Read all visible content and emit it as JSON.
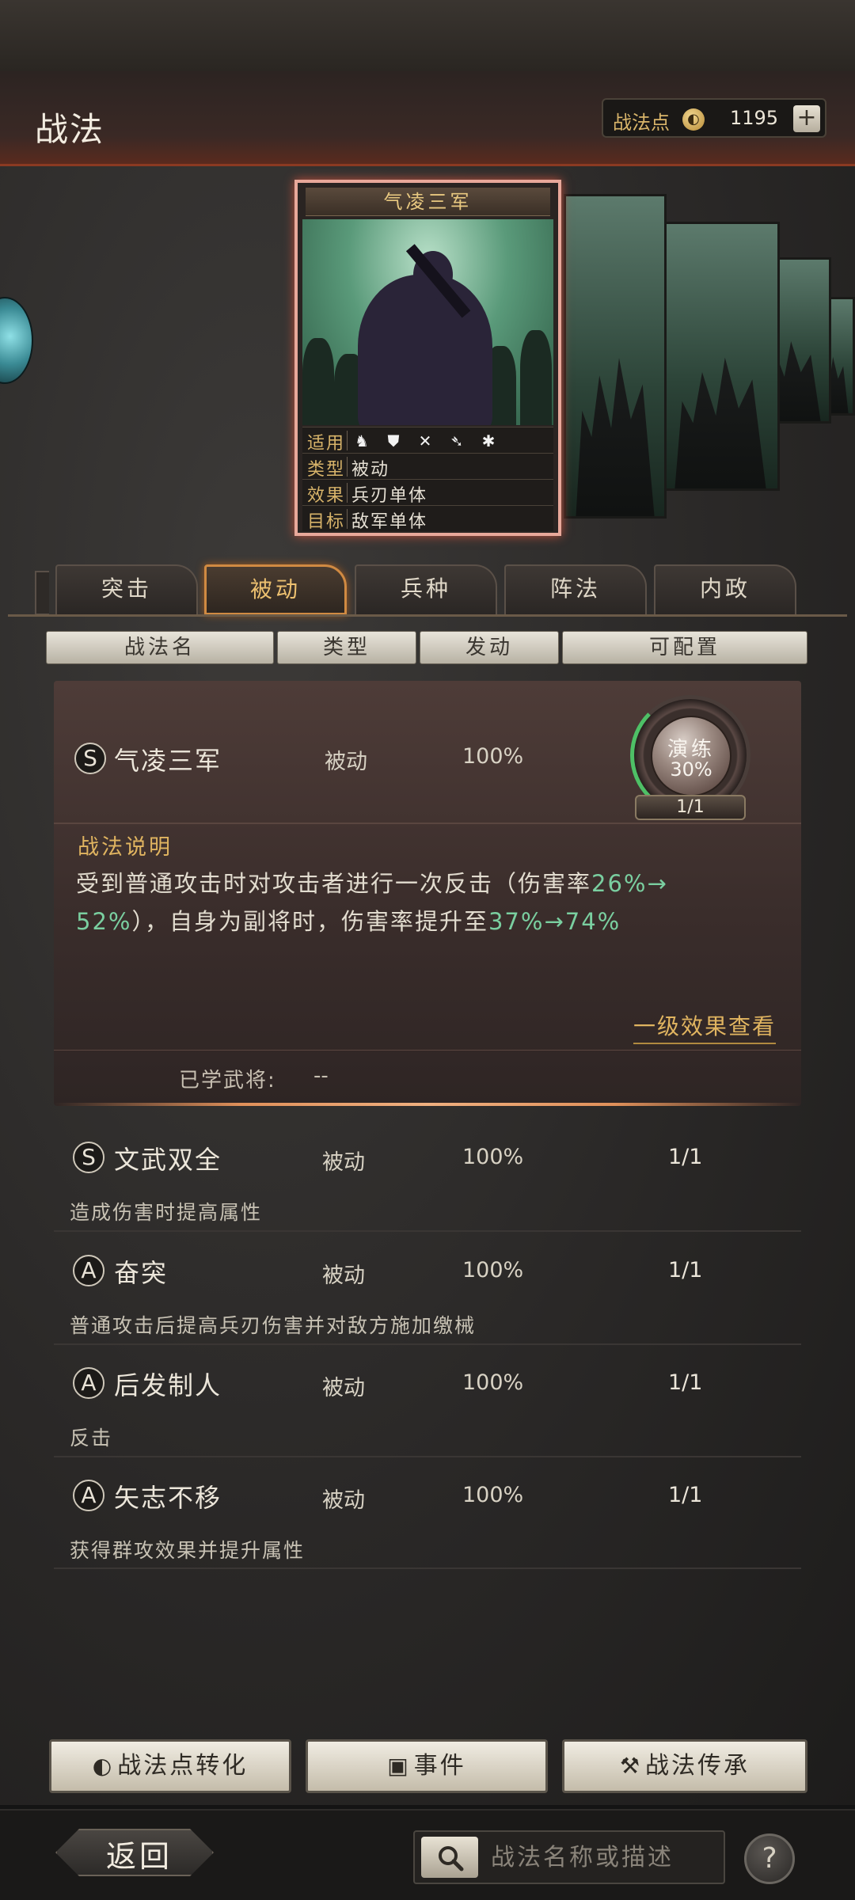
{
  "header": {
    "title": "战法",
    "points_label": "战法点",
    "points_icon": "coin-icon",
    "points_value": "1195",
    "add_label": "+"
  },
  "card": {
    "title": "气凌三军",
    "stats": [
      {
        "key": "适用",
        "value": ""
      },
      {
        "key": "类型",
        "value": "被动"
      },
      {
        "key": "效果",
        "value": "兵刃单体"
      },
      {
        "key": "目标",
        "value": "敌军单体"
      }
    ],
    "apply_icons": [
      "cavalry-icon",
      "shield-icon",
      "bow-icon",
      "spear-icon",
      "siege-icon"
    ]
  },
  "tabs": [
    {
      "label": "突击",
      "active": false
    },
    {
      "label": "被动",
      "active": true
    },
    {
      "label": "兵种",
      "active": false
    },
    {
      "label": "阵法",
      "active": false
    },
    {
      "label": "内政",
      "active": false
    }
  ],
  "columns": [
    "战法名",
    "类型",
    "发动",
    "可配置"
  ],
  "selected": {
    "grade": "S",
    "name": "气凌三军",
    "type": "被动",
    "rate": "100%",
    "train_label": "演练",
    "train_pct": "30%",
    "train_count": "1/1",
    "desc_title": "战法说明",
    "desc_parts": [
      "受到普通攻击时对攻击者进行一次反击（伤害率",
      "26%→",
      "52%",
      "），自身为副将时，伤害率提升至",
      "37%→74%"
    ],
    "level_link": "一级效果查看",
    "learned_label": "已学武将:",
    "learned_value": "--"
  },
  "rows": [
    {
      "grade": "S",
      "name": "文武双全",
      "type": "被动",
      "rate": "100%",
      "cfg": "1/1",
      "desc": "造成伤害时提高属性"
    },
    {
      "grade": "A",
      "name": "奋突",
      "type": "被动",
      "rate": "100%",
      "cfg": "1/1",
      "desc": "普通攻击后提高兵刃伤害并对敌方施加缴械"
    },
    {
      "grade": "A",
      "name": "后发制人",
      "type": "被动",
      "rate": "100%",
      "cfg": "1/1",
      "desc": "反击"
    },
    {
      "grade": "A",
      "name": "矢志不移",
      "type": "被动",
      "rate": "100%",
      "cfg": "1/1",
      "desc": "获得群攻效果并提升属性"
    }
  ],
  "actions": {
    "convert_label": "战法点转化",
    "event_label": "事件",
    "inherit_label": "战法传承"
  },
  "footer": {
    "back_label": "返回",
    "search_placeholder": "战法名称或描述",
    "help_label": "?"
  },
  "colors": {
    "accent_gold": "#e0b460",
    "highlight_green": "#7acfa0",
    "active_tab_border": "#d08a42"
  }
}
